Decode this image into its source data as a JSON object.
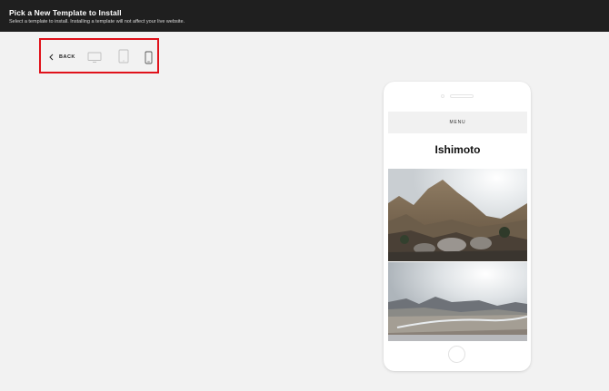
{
  "header": {
    "title": "Pick a New Template to Install",
    "subtitle": "Select a template to install. Installing a template will not affect your live website."
  },
  "toolbar": {
    "back_label": "BACK",
    "devices": [
      "desktop",
      "tablet",
      "phone"
    ],
    "selected_device": "phone"
  },
  "preview": {
    "menu_label": "MENU",
    "site_title": "Ishimoto"
  },
  "colors": {
    "topbar": "#1f1f1f",
    "highlight_border": "#e0121b",
    "canvas": "#f2f2f2"
  }
}
